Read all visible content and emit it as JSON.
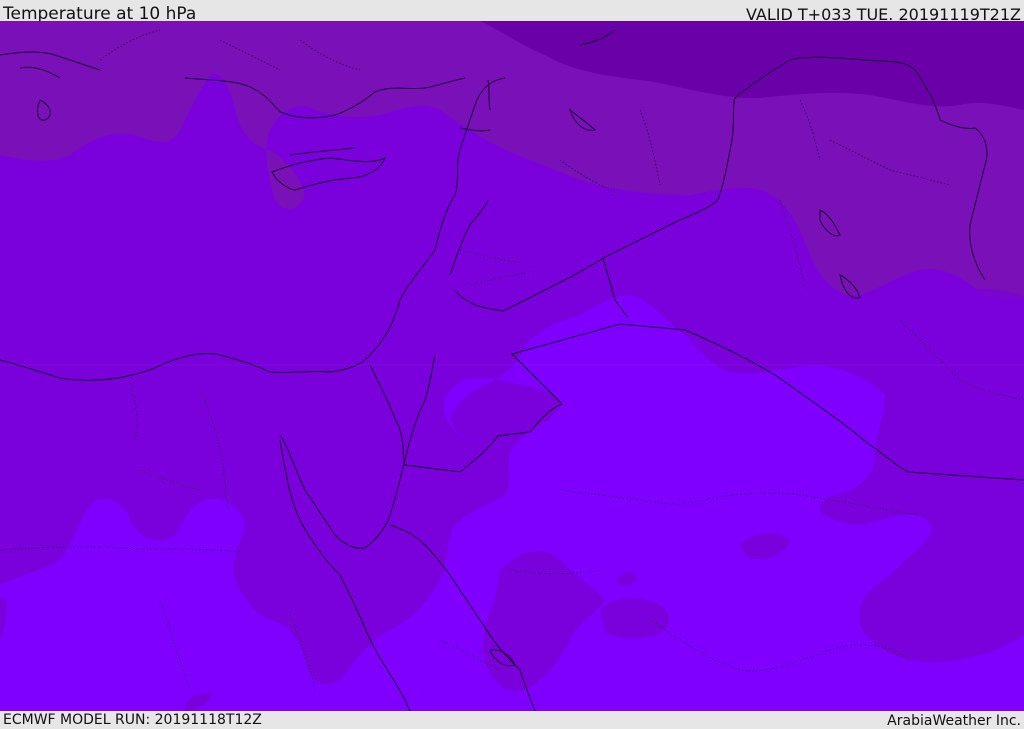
{
  "header": {
    "title": "Temperature at 10 hPa",
    "valid_time": "VALID T+033 TUE. 20191119T21Z"
  },
  "footer": {
    "model_run": "ECMWF MODEL RUN: 20191118T12Z",
    "brand": "ArabiaWeather Inc."
  },
  "map": {
    "colors": {
      "darkest": "#6a00a8",
      "dark": "#7a10b8",
      "mid": "#7a00dc",
      "light": "#7e00f0",
      "lightest": "#7f00ff"
    }
  }
}
